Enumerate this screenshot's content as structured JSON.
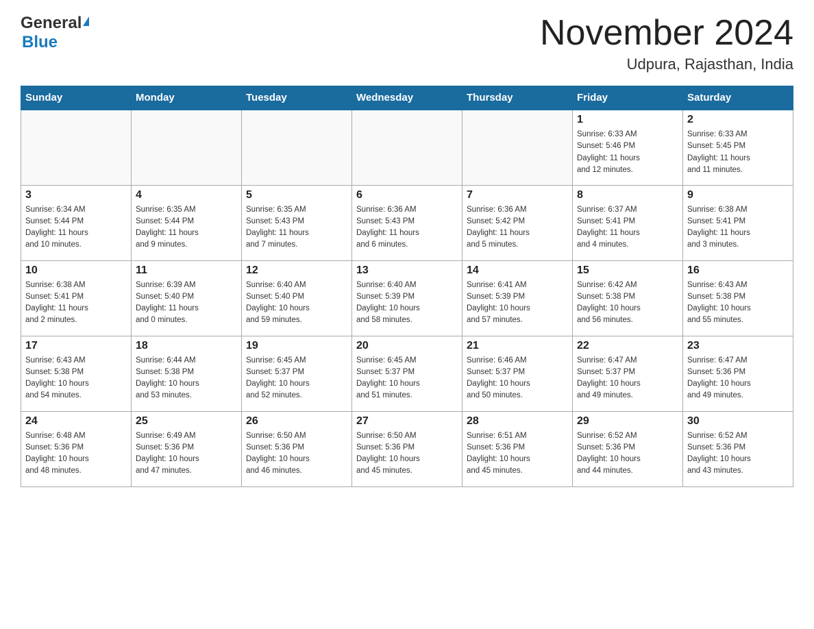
{
  "header": {
    "logo_general": "General",
    "logo_blue": "Blue",
    "month_title": "November 2024",
    "location": "Udpura, Rajasthan, India"
  },
  "weekdays": [
    "Sunday",
    "Monday",
    "Tuesday",
    "Wednesday",
    "Thursday",
    "Friday",
    "Saturday"
  ],
  "weeks": [
    [
      {
        "day": "",
        "info": ""
      },
      {
        "day": "",
        "info": ""
      },
      {
        "day": "",
        "info": ""
      },
      {
        "day": "",
        "info": ""
      },
      {
        "day": "",
        "info": ""
      },
      {
        "day": "1",
        "info": "Sunrise: 6:33 AM\nSunset: 5:46 PM\nDaylight: 11 hours\nand 12 minutes."
      },
      {
        "day": "2",
        "info": "Sunrise: 6:33 AM\nSunset: 5:45 PM\nDaylight: 11 hours\nand 11 minutes."
      }
    ],
    [
      {
        "day": "3",
        "info": "Sunrise: 6:34 AM\nSunset: 5:44 PM\nDaylight: 11 hours\nand 10 minutes."
      },
      {
        "day": "4",
        "info": "Sunrise: 6:35 AM\nSunset: 5:44 PM\nDaylight: 11 hours\nand 9 minutes."
      },
      {
        "day": "5",
        "info": "Sunrise: 6:35 AM\nSunset: 5:43 PM\nDaylight: 11 hours\nand 7 minutes."
      },
      {
        "day": "6",
        "info": "Sunrise: 6:36 AM\nSunset: 5:43 PM\nDaylight: 11 hours\nand 6 minutes."
      },
      {
        "day": "7",
        "info": "Sunrise: 6:36 AM\nSunset: 5:42 PM\nDaylight: 11 hours\nand 5 minutes."
      },
      {
        "day": "8",
        "info": "Sunrise: 6:37 AM\nSunset: 5:41 PM\nDaylight: 11 hours\nand 4 minutes."
      },
      {
        "day": "9",
        "info": "Sunrise: 6:38 AM\nSunset: 5:41 PM\nDaylight: 11 hours\nand 3 minutes."
      }
    ],
    [
      {
        "day": "10",
        "info": "Sunrise: 6:38 AM\nSunset: 5:41 PM\nDaylight: 11 hours\nand 2 minutes."
      },
      {
        "day": "11",
        "info": "Sunrise: 6:39 AM\nSunset: 5:40 PM\nDaylight: 11 hours\nand 0 minutes."
      },
      {
        "day": "12",
        "info": "Sunrise: 6:40 AM\nSunset: 5:40 PM\nDaylight: 10 hours\nand 59 minutes."
      },
      {
        "day": "13",
        "info": "Sunrise: 6:40 AM\nSunset: 5:39 PM\nDaylight: 10 hours\nand 58 minutes."
      },
      {
        "day": "14",
        "info": "Sunrise: 6:41 AM\nSunset: 5:39 PM\nDaylight: 10 hours\nand 57 minutes."
      },
      {
        "day": "15",
        "info": "Sunrise: 6:42 AM\nSunset: 5:38 PM\nDaylight: 10 hours\nand 56 minutes."
      },
      {
        "day": "16",
        "info": "Sunrise: 6:43 AM\nSunset: 5:38 PM\nDaylight: 10 hours\nand 55 minutes."
      }
    ],
    [
      {
        "day": "17",
        "info": "Sunrise: 6:43 AM\nSunset: 5:38 PM\nDaylight: 10 hours\nand 54 minutes."
      },
      {
        "day": "18",
        "info": "Sunrise: 6:44 AM\nSunset: 5:38 PM\nDaylight: 10 hours\nand 53 minutes."
      },
      {
        "day": "19",
        "info": "Sunrise: 6:45 AM\nSunset: 5:37 PM\nDaylight: 10 hours\nand 52 minutes."
      },
      {
        "day": "20",
        "info": "Sunrise: 6:45 AM\nSunset: 5:37 PM\nDaylight: 10 hours\nand 51 minutes."
      },
      {
        "day": "21",
        "info": "Sunrise: 6:46 AM\nSunset: 5:37 PM\nDaylight: 10 hours\nand 50 minutes."
      },
      {
        "day": "22",
        "info": "Sunrise: 6:47 AM\nSunset: 5:37 PM\nDaylight: 10 hours\nand 49 minutes."
      },
      {
        "day": "23",
        "info": "Sunrise: 6:47 AM\nSunset: 5:36 PM\nDaylight: 10 hours\nand 49 minutes."
      }
    ],
    [
      {
        "day": "24",
        "info": "Sunrise: 6:48 AM\nSunset: 5:36 PM\nDaylight: 10 hours\nand 48 minutes."
      },
      {
        "day": "25",
        "info": "Sunrise: 6:49 AM\nSunset: 5:36 PM\nDaylight: 10 hours\nand 47 minutes."
      },
      {
        "day": "26",
        "info": "Sunrise: 6:50 AM\nSunset: 5:36 PM\nDaylight: 10 hours\nand 46 minutes."
      },
      {
        "day": "27",
        "info": "Sunrise: 6:50 AM\nSunset: 5:36 PM\nDaylight: 10 hours\nand 45 minutes."
      },
      {
        "day": "28",
        "info": "Sunrise: 6:51 AM\nSunset: 5:36 PM\nDaylight: 10 hours\nand 45 minutes."
      },
      {
        "day": "29",
        "info": "Sunrise: 6:52 AM\nSunset: 5:36 PM\nDaylight: 10 hours\nand 44 minutes."
      },
      {
        "day": "30",
        "info": "Sunrise: 6:52 AM\nSunset: 5:36 PM\nDaylight: 10 hours\nand 43 minutes."
      }
    ]
  ]
}
